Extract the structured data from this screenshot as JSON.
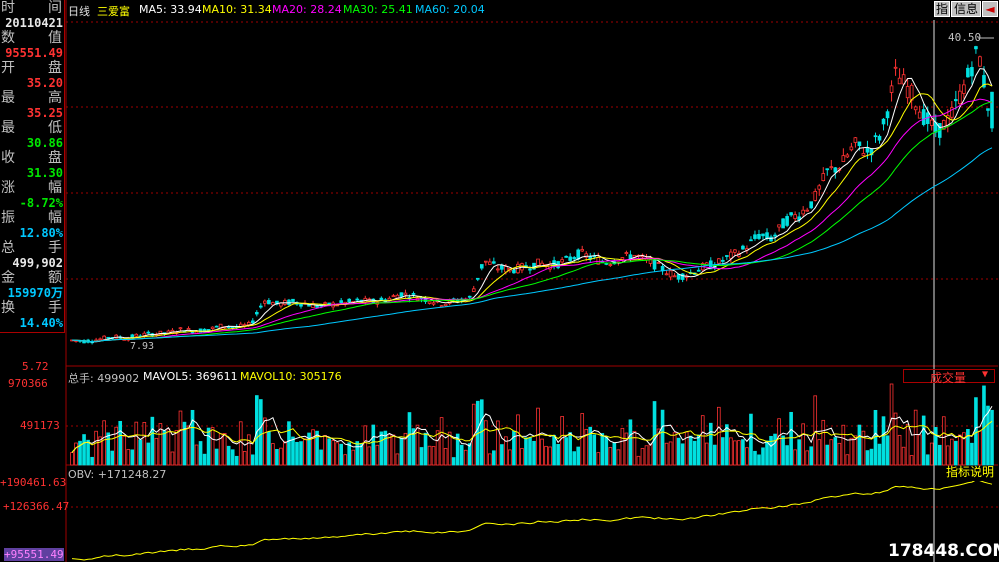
{
  "header": {
    "period": "日线",
    "stock_name": "三爱富",
    "ma5": "MA5: 33.94",
    "ma10": "MA10: 31.34",
    "ma20": "MA20: 28.24",
    "ma30": "MA30: 25.41",
    "ma60": "MA60: 20.04",
    "btn_index": "指",
    "btn_info": "信息",
    "btn_back": "◄"
  },
  "info_panel": [
    {
      "l": "时",
      "r": "间",
      "value": "20110421",
      "color": "white"
    },
    {
      "l": "数",
      "r": "值",
      "value": "95551.49",
      "color": "red"
    },
    {
      "l": "开",
      "r": "盘",
      "value": "35.20",
      "color": "red"
    },
    {
      "l": "最",
      "r": "高",
      "value": "35.25",
      "color": "red"
    },
    {
      "l": "最",
      "r": "低",
      "value": "30.86",
      "color": "green"
    },
    {
      "l": "收",
      "r": "盘",
      "value": "31.30",
      "color": "green"
    },
    {
      "l": "涨",
      "r": "幅",
      "value": "-8.72%",
      "color": "green"
    },
    {
      "l": "振",
      "r": "幅",
      "value": "12.80%",
      "color": "cyan"
    },
    {
      "l": "总",
      "r": "手",
      "value": "499,902",
      "color": "white"
    },
    {
      "l": "金",
      "r": "额",
      "value": "159970万",
      "color": "cyan"
    },
    {
      "l": "换",
      "r": "手",
      "value": "14.40%",
      "color": "cyan"
    }
  ],
  "price_panel": {
    "max_label": "40.50",
    "min_label": "7.93",
    "bottom_axis": "5.72"
  },
  "volume_panel": {
    "title_total": "总手: 499902",
    "title_mavol5": "MAVOL5: 369611",
    "title_mavol10": "MAVOL10: 305176",
    "selector": "成交量",
    "selector_arrow": "▼",
    "axis_top": "970366",
    "axis_mid": "491173"
  },
  "obv_panel": {
    "title": "OBV: +171248.27",
    "button": "指标说明",
    "axis_top": "+190461.63",
    "axis_mid": "+126366.47",
    "axis_bottom": "+95551.49"
  },
  "watermark": "178448.COM",
  "colors": {
    "up": "#ff3232",
    "down": "#00e0e0",
    "ma5": "#ffffff",
    "ma10": "#ffff00",
    "ma20": "#ff00ff",
    "ma30": "#00ff00",
    "ma60": "#00c8ff",
    "obv": "#ffff00",
    "grid": "#a00000"
  },
  "chart_data": {
    "type": "candlestick",
    "price_range": [
      5.72,
      42.0
    ],
    "candles_ohlc_anchor": [
      [
        7.9,
        8.3,
        7.8,
        8.1
      ],
      [
        8.1,
        8.4,
        7.9,
        8.0
      ],
      [
        8.0,
        8.3,
        7.9,
        8.2
      ],
      [
        8.2,
        8.6,
        8.0,
        8.5
      ],
      [
        8.5,
        8.7,
        8.2,
        8.3
      ],
      [
        8.3,
        8.8,
        8.2,
        8.7
      ],
      [
        8.7,
        9.0,
        8.5,
        8.8
      ],
      [
        8.8,
        9.1,
        8.6,
        8.9
      ],
      [
        8.9,
        9.4,
        8.8,
        9.3
      ],
      [
        9.3,
        9.5,
        9.0,
        9.1
      ],
      [
        9.1,
        9.4,
        8.9,
        9.3
      ],
      [
        9.3,
        9.8,
        9.2,
        9.7
      ],
      [
        9.7,
        10.0,
        9.4,
        9.5
      ],
      [
        9.5,
        9.9,
        9.3,
        9.8
      ],
      [
        9.8,
        12.8,
        9.7,
        12.5
      ],
      [
        12.5,
        13.2,
        11.8,
        12.0
      ],
      [
        12.0,
        12.6,
        11.5,
        12.3
      ],
      [
        12.3,
        12.8,
        11.9,
        12.1
      ],
      [
        12.1,
        12.5,
        11.6,
        11.8
      ],
      [
        11.8,
        12.2,
        11.4,
        12.0
      ],
      [
        12.0,
        12.4,
        11.7,
        12.2
      ],
      [
        12.2,
        12.7,
        11.9,
        12.4
      ],
      [
        12.4,
        12.9,
        12.0,
        12.3
      ],
      [
        12.3,
        12.8,
        12.0,
        12.6
      ],
      [
        12.6,
        13.5,
        12.4,
        13.2
      ],
      [
        13.2,
        13.6,
        12.7,
        12.9
      ],
      [
        12.9,
        13.2,
        12.3,
        12.5
      ],
      [
        12.5,
        12.9,
        12.0,
        12.1
      ],
      [
        12.1,
        12.6,
        11.8,
        12.4
      ],
      [
        12.4,
        12.9,
        12.1,
        12.7
      ],
      [
        12.7,
        17.5,
        12.6,
        16.8
      ],
      [
        16.8,
        17.4,
        15.6,
        16.0
      ],
      [
        16.0,
        16.6,
        15.2,
        15.8
      ],
      [
        15.8,
        16.4,
        15.3,
        16.1
      ],
      [
        16.1,
        16.8,
        15.7,
        16.5
      ],
      [
        16.5,
        17.2,
        16.0,
        16.3
      ],
      [
        16.3,
        17.0,
        15.9,
        16.8
      ],
      [
        16.8,
        18.2,
        16.5,
        17.6
      ],
      [
        17.6,
        18.0,
        16.8,
        17.0
      ],
      [
        17.0,
        17.4,
        16.2,
        16.6
      ],
      [
        16.6,
        17.3,
        16.2,
        17.1
      ],
      [
        17.1,
        17.9,
        16.8,
        17.4
      ],
      [
        17.4,
        17.6,
        16.4,
        16.7
      ],
      [
        16.7,
        17.0,
        15.6,
        15.9
      ],
      [
        15.9,
        16.1,
        14.6,
        15.0
      ],
      [
        15.0,
        15.6,
        14.5,
        15.4
      ],
      [
        15.4,
        16.3,
        15.1,
        16.1
      ],
      [
        16.1,
        16.8,
        15.8,
        16.5
      ],
      [
        16.5,
        17.6,
        16.3,
        17.3
      ],
      [
        17.3,
        18.3,
        17.0,
        18.1
      ],
      [
        18.1,
        19.8,
        17.9,
        19.6
      ],
      [
        19.6,
        20.2,
        18.9,
        19.2
      ],
      [
        19.2,
        21.5,
        19.0,
        21.2
      ],
      [
        21.2,
        22.3,
        20.8,
        21.9
      ],
      [
        21.9,
        23.6,
        21.5,
        23.3
      ],
      [
        23.3,
        26.8,
        23.1,
        26.5
      ],
      [
        26.5,
        27.8,
        25.6,
        27.2
      ],
      [
        27.2,
        29.8,
        26.9,
        29.5
      ],
      [
        29.5,
        30.3,
        28.2,
        28.6
      ],
      [
        28.6,
        31.2,
        28.4,
        30.9
      ],
      [
        30.9,
        37.6,
        30.5,
        37.2
      ],
      [
        37.2,
        38.0,
        35.0,
        35.4
      ],
      [
        35.4,
        36.0,
        32.1,
        32.6
      ],
      [
        32.6,
        33.0,
        30.2,
        30.8
      ],
      [
        30.8,
        32.8,
        30.5,
        32.5
      ],
      [
        32.5,
        36.4,
        32.2,
        36.0
      ],
      [
        36.0,
        40.5,
        35.8,
        39.9
      ],
      [
        35.2,
        35.25,
        30.86,
        31.3
      ]
    ]
  }
}
